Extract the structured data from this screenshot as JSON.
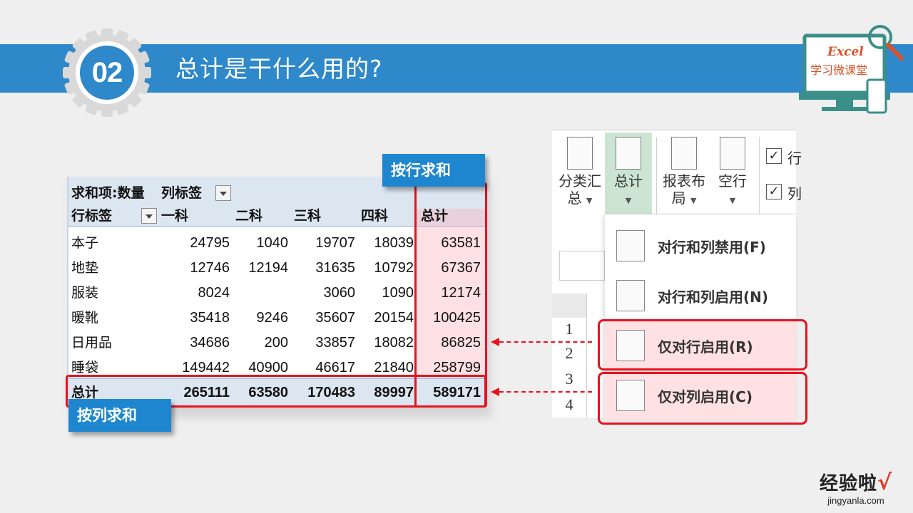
{
  "header": {
    "badge_number": "02",
    "title": "总计是干什么用的?",
    "logo_text": "Excel",
    "logo_subtitle": "学习微课堂"
  },
  "pivot": {
    "sum_label": "求和项:数量",
    "col_label": "列标签",
    "row_label": "行标签",
    "columns": [
      "一科",
      "二科",
      "三科",
      "四科",
      "总计"
    ],
    "rows": [
      {
        "name": "本子",
        "values": [
          "24795",
          "1040",
          "19707",
          "18039",
          "63581"
        ]
      },
      {
        "name": "地垫",
        "values": [
          "12746",
          "12194",
          "31635",
          "10792",
          "67367"
        ]
      },
      {
        "name": "服装",
        "values": [
          "8024",
          "",
          "3060",
          "1090",
          "12174"
        ]
      },
      {
        "name": "暖靴",
        "values": [
          "35418",
          "9246",
          "35607",
          "20154",
          "100425"
        ]
      },
      {
        "name": "日用品",
        "values": [
          "34686",
          "200",
          "33857",
          "18082",
          "86825"
        ]
      },
      {
        "name": "睡袋",
        "values": [
          "149442",
          "40900",
          "46617",
          "21840",
          "258799"
        ]
      }
    ],
    "total_row": {
      "name": "总计",
      "values": [
        "265111",
        "63580",
        "170483",
        "89997",
        "589171"
      ]
    }
  },
  "tags": {
    "row_sum": "按行求和",
    "col_sum": "按列求和"
  },
  "ribbon": {
    "subtotal": "分类汇总",
    "subtotal_line1": "分类汇",
    "subtotal_line2": "总",
    "grand_total": "总计",
    "report_layout_line1": "报表布",
    "report_layout_line2": "局",
    "blank_row": "空行",
    "check1": "行",
    "check2": "列"
  },
  "menu": {
    "items": [
      {
        "label": "对行和列禁用(F)"
      },
      {
        "label": "对行和列启用(N)"
      },
      {
        "label": "仅对行启用(R)"
      },
      {
        "label": "仅对列启用(C)"
      }
    ]
  },
  "sheet": {
    "row_numbers": [
      "1",
      "2",
      "3",
      "4"
    ]
  },
  "watermark": {
    "main": "经验啦",
    "check": "√",
    "url": "jingyanla.com"
  },
  "colors": {
    "accent": "#2e88c9",
    "highlight_red": "#e8121e",
    "pivot_header": "#dce6f1"
  }
}
